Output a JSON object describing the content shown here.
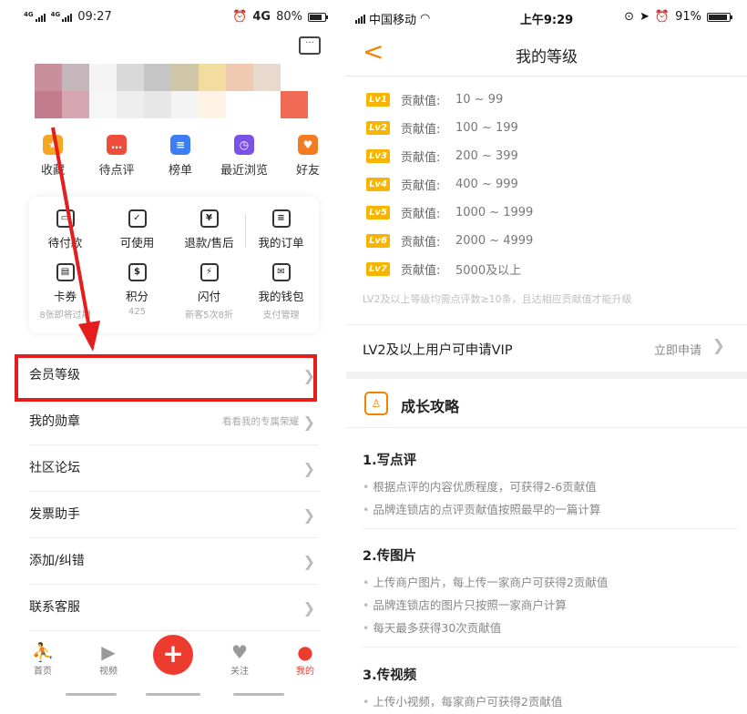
{
  "left": {
    "status": {
      "net1": "4G",
      "net2": "4G",
      "time": "09:27",
      "net3": "4G",
      "battery": "80%"
    },
    "message_icon": "message-icon",
    "quick": [
      {
        "label": "收藏",
        "icon": "star-icon",
        "color": "#f5a623"
      },
      {
        "label": "待点评",
        "icon": "comment-icon",
        "color": "#ee4d3c"
      },
      {
        "label": "榜单",
        "icon": "list-icon",
        "color": "#3b7ef6"
      },
      {
        "label": "最近浏览",
        "icon": "clock-icon",
        "color": "#7b52e8"
      },
      {
        "label": "好友",
        "icon": "heart-icon",
        "color": "#f27b24"
      }
    ],
    "grid": [
      {
        "label": "待付款",
        "sub": "",
        "icon": "wallet-icon"
      },
      {
        "label": "可使用",
        "sub": "",
        "icon": "ticket-check-icon"
      },
      {
        "label": "退款/售后",
        "sub": "",
        "icon": "refund-icon"
      },
      {
        "label": "我的订单",
        "sub": "",
        "icon": "order-icon"
      },
      {
        "label": "卡券",
        "sub": "8张即将过期",
        "icon": "card-icon"
      },
      {
        "label": "积分",
        "sub": "425",
        "icon": "points-icon"
      },
      {
        "label": "闪付",
        "sub": "新客5次8折",
        "icon": "quickpay-icon"
      },
      {
        "label": "我的钱包",
        "sub": "支付管理",
        "icon": "purse-icon"
      }
    ],
    "menu": [
      {
        "label": "会员等级",
        "hint": ""
      },
      {
        "label": "我的勋章",
        "hint": "看看我的专属荣耀"
      },
      {
        "label": "社区论坛",
        "hint": ""
      },
      {
        "label": "发票助手",
        "hint": ""
      },
      {
        "label": "添加/纠错",
        "hint": ""
      },
      {
        "label": "联系客服",
        "hint": ""
      }
    ],
    "tabs": [
      {
        "label": "首页",
        "icon": "home-icon"
      },
      {
        "label": "视频",
        "icon": "video-icon"
      },
      {
        "label": "关注",
        "icon": "heart-icon"
      },
      {
        "label": "我的",
        "icon": "user-icon"
      }
    ],
    "plus_label": "+",
    "accent": "#ee3b2f"
  },
  "right": {
    "status": {
      "carrier": "中国移动",
      "time": "上午9:29",
      "battery": "91%"
    },
    "title": "我的等级",
    "back": "<",
    "levels": [
      {
        "badge": "Lv1",
        "label": "贡献值:",
        "range": "10 ~ 99"
      },
      {
        "badge": "Lv2",
        "label": "贡献值:",
        "range": "100 ~ 199"
      },
      {
        "badge": "Lv3",
        "label": "贡献值:",
        "range": "200 ~ 399"
      },
      {
        "badge": "Lv4",
        "label": "贡献值:",
        "range": "400 ~ 999"
      },
      {
        "badge": "Lv5",
        "label": "贡献值:",
        "range": "1000 ~ 1999"
      },
      {
        "badge": "Lv6",
        "label": "贡献值:",
        "range": "2000 ~ 4999"
      },
      {
        "badge": "Lv7",
        "label": "贡献值:",
        "range": "5000及以上"
      }
    ],
    "note": "LV2及以上等级均需点评数≥10条，且达相应贡献值才能升级",
    "vip": {
      "text": "LV2及以上用户可申请VIP",
      "action": "立即申请"
    },
    "growth_title": "成长攻略",
    "sections": [
      {
        "title": "1.写点评",
        "items": [
          "根据点评的内容优质程度，可获得2-6贡献值",
          "品牌连锁店的点评贡献值按照最早的一篇计算"
        ]
      },
      {
        "title": "2.传图片",
        "items": [
          "上传商户图片，每上传一家商户可获得2贡献值",
          "品牌连锁店的图片只按照一家商户计算",
          "每天最多获得30次贡献值"
        ]
      },
      {
        "title": "3.传视频",
        "items": [
          "上传小视频，每家商户可获得2贡献值"
        ]
      }
    ],
    "badge_color": "#f7b500",
    "accent": "#f08300"
  }
}
